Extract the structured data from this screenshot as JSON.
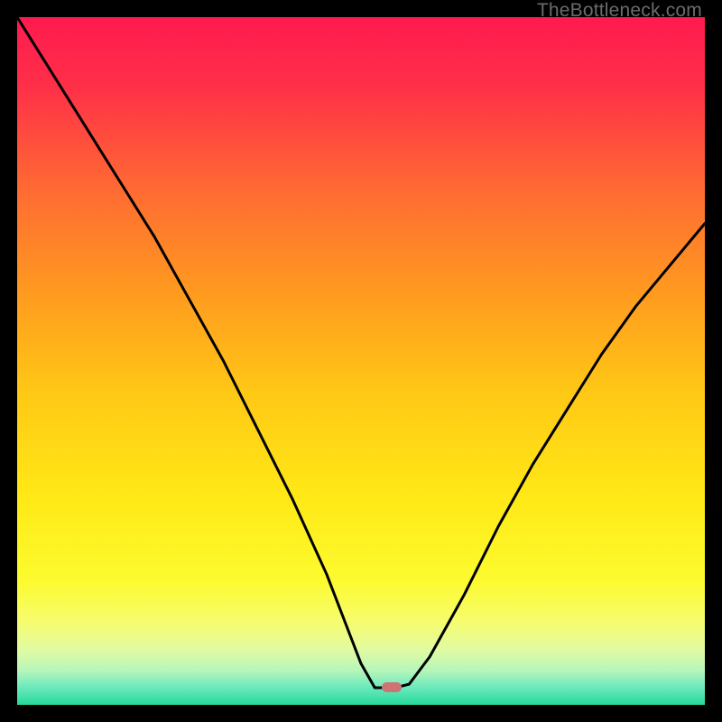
{
  "watermark": "TheBottleneck.com",
  "marker": {
    "x_pct": 54.5,
    "y_pct": 97.4
  },
  "gradient_stops": [
    {
      "offset": 0,
      "color": "#ff1a4f"
    },
    {
      "offset": 0.1,
      "color": "#ff2f48"
    },
    {
      "offset": 0.25,
      "color": "#ff6a33"
    },
    {
      "offset": 0.4,
      "color": "#ff9a1f"
    },
    {
      "offset": 0.55,
      "color": "#ffc915"
    },
    {
      "offset": 0.7,
      "color": "#ffe916"
    },
    {
      "offset": 0.82,
      "color": "#fcfb2f"
    },
    {
      "offset": 0.88,
      "color": "#f6fc6f"
    },
    {
      "offset": 0.92,
      "color": "#e1fba2"
    },
    {
      "offset": 0.95,
      "color": "#b6f6ba"
    },
    {
      "offset": 0.975,
      "color": "#6ae9bd"
    },
    {
      "offset": 1.0,
      "color": "#25d99a"
    }
  ],
  "chart_data": {
    "type": "line",
    "title": "",
    "xlabel": "",
    "ylabel": "",
    "xlim": [
      0,
      100
    ],
    "ylim": [
      0,
      100
    ],
    "grid": false,
    "series": [
      {
        "name": "bottleneck-curve",
        "x": [
          0,
          5,
          10,
          15,
          20,
          25,
          30,
          35,
          40,
          45,
          50,
          52,
          55,
          57,
          60,
          65,
          70,
          75,
          80,
          85,
          90,
          95,
          100
        ],
        "y": [
          100,
          92,
          84,
          76,
          68,
          59,
          50,
          40,
          30,
          19,
          6,
          2.5,
          2.5,
          3,
          7,
          16,
          26,
          35,
          43,
          51,
          58,
          64,
          70
        ]
      }
    ],
    "annotations": [
      {
        "type": "marker",
        "shape": "pill",
        "color": "#cf7272",
        "x": 54.5,
        "y": 2.6
      }
    ]
  }
}
